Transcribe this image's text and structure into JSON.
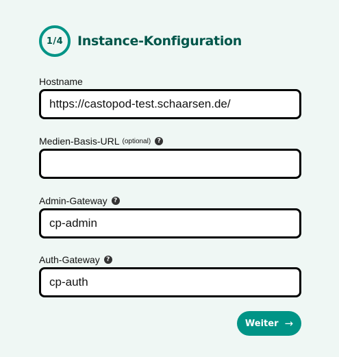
{
  "step": {
    "indicator": "1/4",
    "title": "Instance-Konfiguration"
  },
  "fields": {
    "hostname": {
      "label": "Hostname",
      "value": "https://castopod-test.schaarsen.de/"
    },
    "media_base_url": {
      "label": "Medien-Basis-URL",
      "optional": "(optional)",
      "value": ""
    },
    "admin_gateway": {
      "label": "Admin-Gateway",
      "value": "cp-admin"
    },
    "auth_gateway": {
      "label": "Auth-Gateway",
      "value": "cp-auth"
    }
  },
  "help_glyph": "?",
  "actions": {
    "next_label": "Weiter",
    "next_icon": "→"
  },
  "colors": {
    "background": "#eff7f4",
    "accent": "#009486",
    "title": "#00564a"
  }
}
